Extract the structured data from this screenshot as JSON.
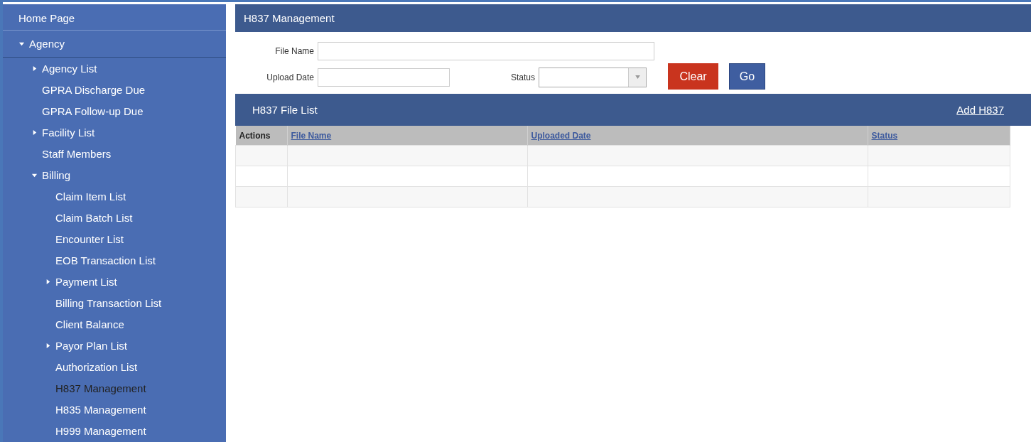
{
  "sidebar": {
    "items": [
      {
        "label": "Home Page",
        "selected": false
      },
      {
        "label": "Agency",
        "selected": false,
        "expanded": true,
        "children": [
          {
            "label": "Agency List",
            "selected": false,
            "expanded": false
          },
          {
            "label": "GPRA Discharge Due",
            "selected": false
          },
          {
            "label": "GPRA Follow-up Due",
            "selected": false
          },
          {
            "label": "Facility List",
            "selected": false,
            "expanded": false
          },
          {
            "label": "Staff Members",
            "selected": false
          },
          {
            "label": "Billing",
            "selected": false,
            "expanded": true,
            "children": [
              {
                "label": "Claim Item List",
                "selected": false
              },
              {
                "label": "Claim Batch List",
                "selected": false
              },
              {
                "label": "Encounter List",
                "selected": false
              },
              {
                "label": "EOB Transaction List",
                "selected": false
              },
              {
                "label": "Payment List",
                "selected": false,
                "expanded": false
              },
              {
                "label": "Billing Transaction List",
                "selected": false
              },
              {
                "label": "Client Balance",
                "selected": false
              },
              {
                "label": "Payor Plan List",
                "selected": false,
                "expanded": false
              },
              {
                "label": "Authorization List",
                "selected": false
              },
              {
                "label": "H837 Management",
                "selected": true
              },
              {
                "label": "H835 Management",
                "selected": false
              },
              {
                "label": "H999 Management",
                "selected": false
              }
            ]
          }
        ]
      }
    ]
  },
  "page": {
    "title": "H837 Management"
  },
  "filters": {
    "file_name_label": "File Name",
    "upload_date_label": "Upload Date",
    "status_label": "Status",
    "buttons": [
      {
        "label": "Clear",
        "kind": "danger"
      },
      {
        "label": "Go",
        "kind": "primary"
      }
    ]
  },
  "file_list": {
    "title": "H837 File List",
    "add_link": "Add H837",
    "columns": [
      {
        "label": "Actions",
        "sortable": false
      },
      {
        "label": "File Name",
        "sortable": true
      },
      {
        "label": "Uploaded Date",
        "sortable": true
      },
      {
        "label": "Status",
        "sortable": true
      }
    ]
  }
}
